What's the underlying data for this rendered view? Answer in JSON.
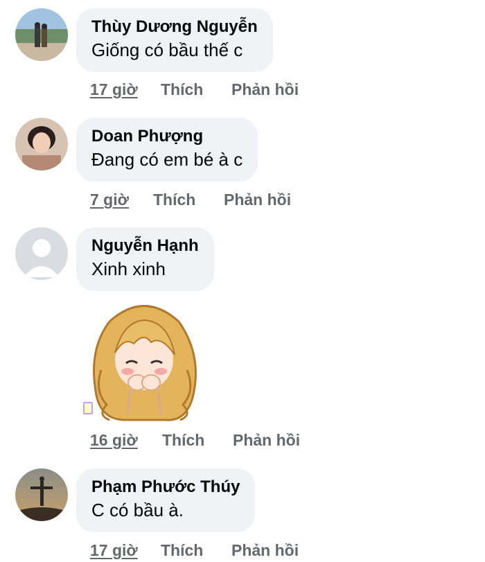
{
  "comments": [
    {
      "author": "Thùy Dương Nguyễn",
      "text": "Giống có bầu thế c",
      "time": "17 giờ",
      "like": "Thích",
      "reply": "Phản hồi"
    },
    {
      "author": "Doan Phượng",
      "text": "Đang có em bé à c",
      "time": "7 giờ",
      "like": "Thích",
      "reply": "Phản hồi"
    },
    {
      "author": "Nguyễn Hạnh",
      "text": "Xinh xinh",
      "time": "16 giờ",
      "like": "Thích",
      "reply": "Phản hồi"
    },
    {
      "author": "Phạm Phước Thúy",
      "text": "C có bầu à.",
      "time": "17 giờ",
      "like": "Thích",
      "reply": "Phản hồi"
    }
  ]
}
